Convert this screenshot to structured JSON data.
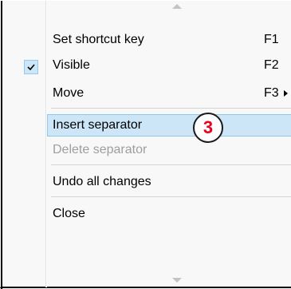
{
  "menu": {
    "items": [
      {
        "label": "Set shortcut key",
        "shortcut": "F1"
      },
      {
        "label": "Visible",
        "shortcut": "F2",
        "checked": true
      },
      {
        "label": "Move",
        "shortcut": "F3",
        "submenu": true
      },
      {
        "label": "Insert separator",
        "hovered": true
      },
      {
        "label": "Delete separator",
        "disabled": true
      },
      {
        "label": "Undo all changes"
      },
      {
        "label": "Close"
      }
    ]
  },
  "annotation": {
    "step": "3"
  },
  "colors": {
    "hover_bg": "#cce6f7",
    "hover_border": "#8fc8ed",
    "badge_text": "#e8001c",
    "disabled_text": "#9e9e9e"
  }
}
